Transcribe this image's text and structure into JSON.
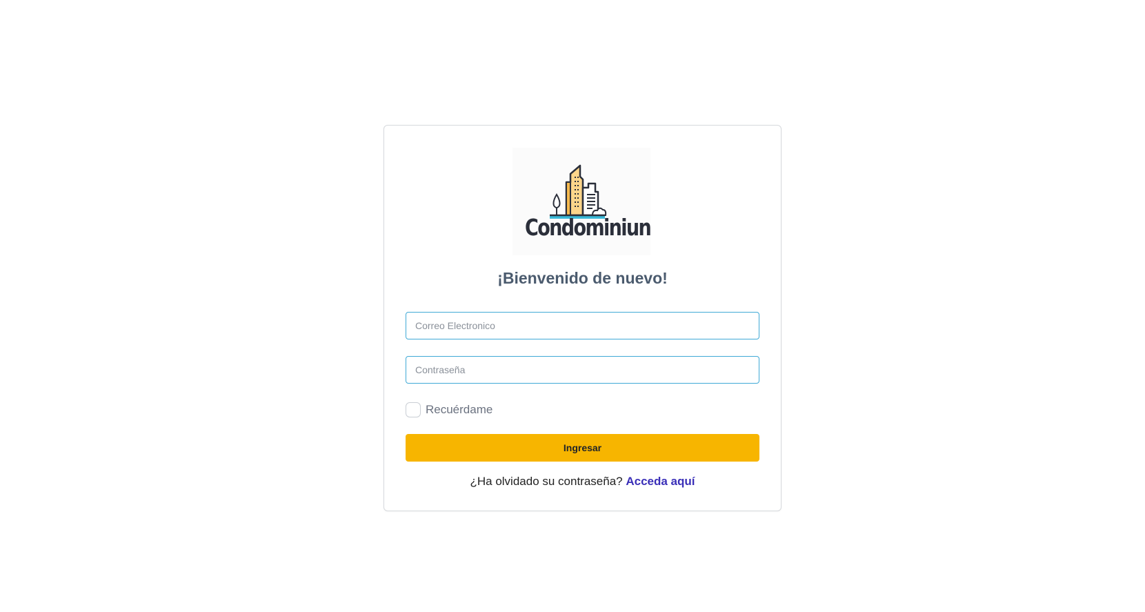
{
  "logo": {
    "text": "Condominiun",
    "icon": "building-logo-icon"
  },
  "title": "¡Bienvenido de nuevo!",
  "form": {
    "email_placeholder": "Correo Electronico",
    "password_placeholder": "Contraseña",
    "remember_label": "Recuérdame",
    "submit_label": "Ingresar"
  },
  "forgot": {
    "question": "¿Ha olvidado su contraseña?",
    "link_label": "Acceda aquí"
  },
  "colors": {
    "accent": "#f7b500",
    "link": "#3a2fb8",
    "input_border": "#3fa9d6",
    "title": "#4b5b6e"
  }
}
